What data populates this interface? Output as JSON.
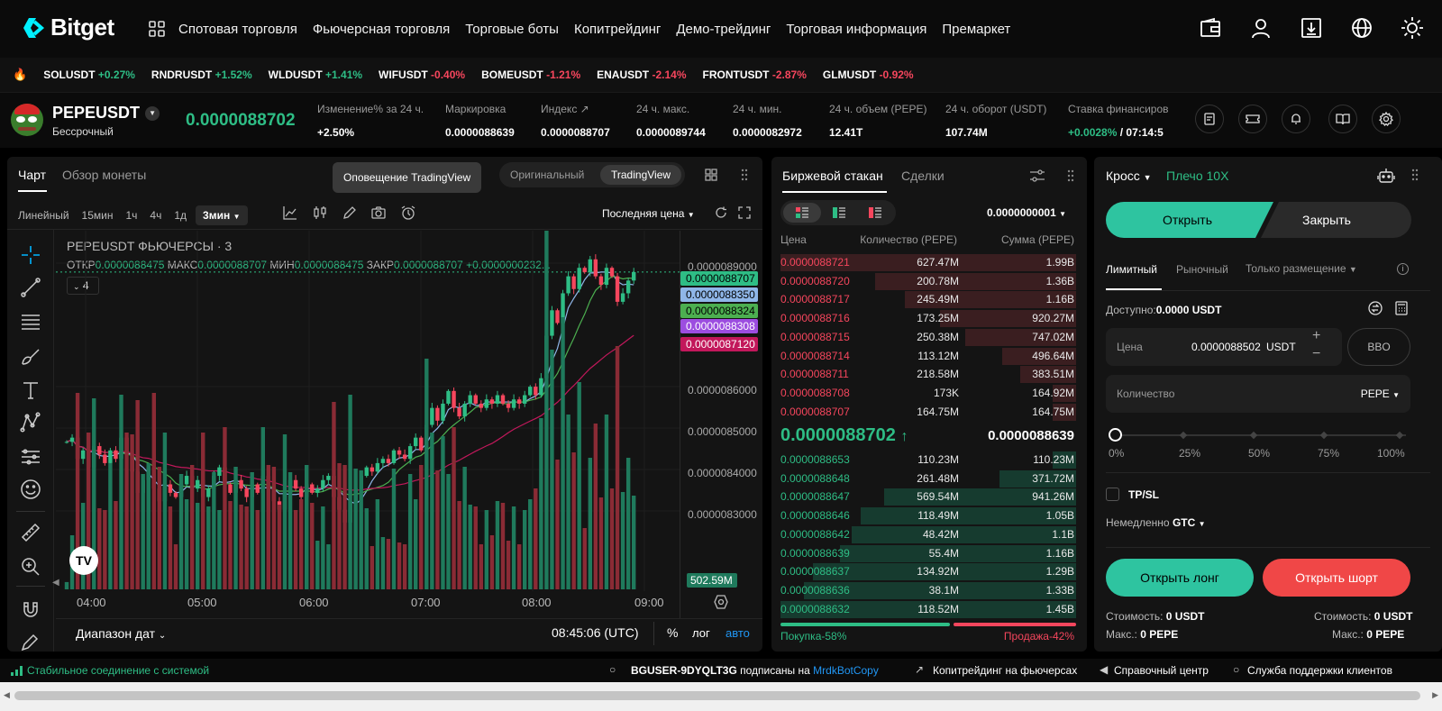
{
  "brand": {
    "name": "Bitget",
    "color": "#00f0ff"
  },
  "nav": [
    "Спотовая торговля",
    "Фьючерсная торговля",
    "Торговые боты",
    "Копитрейдинг",
    "Демо-трейдинг",
    "Торговая информация",
    "Премаркет"
  ],
  "header_icons": [
    "wallet-icon",
    "user-icon",
    "download-icon",
    "globe-icon",
    "sun-icon"
  ],
  "ticker": [
    {
      "sym": "SOLUSDT",
      "chg": "+0.27%",
      "dir": "up"
    },
    {
      "sym": "RNDRUSDT",
      "chg": "+1.52%",
      "dir": "up"
    },
    {
      "sym": "WLDUSDT",
      "chg": "+1.41%",
      "dir": "up"
    },
    {
      "sym": "WIFUSDT",
      "chg": "-0.40%",
      "dir": "dn"
    },
    {
      "sym": "BOMEUSDT",
      "chg": "-1.21%",
      "dir": "dn"
    },
    {
      "sym": "ENAUSDT",
      "chg": "-2.14%",
      "dir": "dn"
    },
    {
      "sym": "FRONTUSDT",
      "chg": "-2.87%",
      "dir": "dn"
    },
    {
      "sym": "GLMUSDT",
      "chg": "-0.92%",
      "dir": "dn"
    }
  ],
  "symbol": {
    "name": "PEPEUSDT",
    "type": "Бессрочный",
    "price": "0.0000088702",
    "stats": [
      {
        "label": "Изменение% за 24 ч.",
        "value": "+2.50%",
        "color": "#2ebd85"
      },
      {
        "label": "Маркировка",
        "value": "0.0000088639",
        "color": "#2ebd85"
      },
      {
        "label": "Индекс",
        "value": "0.0000088707",
        "color": "#ffffff"
      },
      {
        "label": "24 ч. макс.",
        "value": "0.0000089744",
        "color": "#ffffff"
      },
      {
        "label": "24 ч. мин.",
        "value": "0.0000082972",
        "color": "#ffffff"
      },
      {
        "label": "24 ч. объем (PEPE)",
        "value": "12.41T",
        "color": "#ffffff"
      },
      {
        "label": "24 ч. оборот (USDT)",
        "value": "107.74M",
        "color": "#ffffff"
      },
      {
        "label": "Ставка финансиров",
        "value": "+0.0028%",
        "color": "#2ebd85",
        "extra": " / 07:14:5"
      }
    ]
  },
  "chart": {
    "tabs": [
      "Чарт",
      "Обзор монеты"
    ],
    "tooltip": "Оповещение TradingView",
    "view_toggle": [
      "Оригинальный",
      "TradingView"
    ],
    "intervals": [
      "Линейный",
      "15мин",
      "1ч",
      "4ч",
      "1д"
    ],
    "active_interval": "3мин",
    "price_type": "Последняя цена",
    "legend_title": "PEPEUSDT ФЬЮЧЕРСЫ · 3",
    "ohlc": {
      "o_label": "ОТКР",
      "o": "0.0000088475",
      "h_label": "МАКС",
      "h": "0.0000088707",
      "l_label": "МИН",
      "l": "0.0000088475",
      "c_label": "ЗАКР",
      "c": "0.0000088707",
      "chg": "+0.0000000232..."
    },
    "indicator_count": "4",
    "y_ticks": [
      "0.0000089000",
      "0.0000086000",
      "0.0000085000",
      "0.0000084000",
      "0.0000083000"
    ],
    "price_tags": [
      {
        "v": "0.0000088707",
        "bg": "#2ebd85",
        "fg": "#000"
      },
      {
        "v": "0.0000088350",
        "bg": "#8fb6e8",
        "fg": "#000"
      },
      {
        "v": "0.0000088324",
        "bg": "#4caf50",
        "fg": "#000"
      },
      {
        "v": "0.0000088308",
        "bg": "#9c4de0",
        "fg": "#fff"
      },
      {
        "v": "0.0000087120",
        "bg": "#c2185b",
        "fg": "#fff"
      }
    ],
    "volume_tag": "502.59M",
    "x_ticks": [
      "04:00",
      "05:00",
      "06:00",
      "07:00",
      "08:00",
      "09:00"
    ],
    "date_range": "Диапазон дат",
    "time": "08:45:06 (UTC)",
    "scale_opts": [
      "%",
      "лог",
      "авто"
    ]
  },
  "book": {
    "tabs": [
      "Биржевой стакан",
      "Сделки"
    ],
    "precision": "0.0000000001",
    "headers": [
      "Цена",
      "Количество (PEPE)",
      "Сумма (PEPE)"
    ],
    "asks": [
      {
        "p": "0.0000088721",
        "q": "627.47M",
        "t": "1.99B",
        "d": 1.0
      },
      {
        "p": "0.0000088720",
        "q": "200.78M",
        "t": "1.36B",
        "d": 0.68
      },
      {
        "p": "0.0000088717",
        "q": "245.49M",
        "t": "1.16B",
        "d": 0.58
      },
      {
        "p": "0.0000088716",
        "q": "173.25M",
        "t": "920.27M",
        "d": 0.46
      },
      {
        "p": "0.0000088715",
        "q": "250.38M",
        "t": "747.02M",
        "d": 0.375
      },
      {
        "p": "0.0000088714",
        "q": "113.12M",
        "t": "496.64M",
        "d": 0.25
      },
      {
        "p": "0.0000088711",
        "q": "218.58M",
        "t": "383.51M",
        "d": 0.19
      },
      {
        "p": "0.0000088708",
        "q": "173K",
        "t": "164.92M",
        "d": 0.08
      },
      {
        "p": "0.0000088707",
        "q": "164.75M",
        "t": "164.75M",
        "d": 0.08
      }
    ],
    "last": "0.0000088702",
    "mark": "0.0000088639",
    "bids": [
      {
        "p": "0.0000088653",
        "q": "110.23M",
        "t": "110.23M",
        "d": 0.08
      },
      {
        "p": "0.0000088648",
        "q": "261.48M",
        "t": "371.72M",
        "d": 0.26
      },
      {
        "p": "0.0000088647",
        "q": "569.54M",
        "t": "941.26M",
        "d": 0.65
      },
      {
        "p": "0.0000088646",
        "q": "118.49M",
        "t": "1.05B",
        "d": 0.73
      },
      {
        "p": "0.0000088642",
        "q": "48.42M",
        "t": "1.1B",
        "d": 0.76
      },
      {
        "p": "0.0000088639",
        "q": "55.4M",
        "t": "1.16B",
        "d": 0.8
      },
      {
        "p": "0.0000088637",
        "q": "134.92M",
        "t": "1.29B",
        "d": 0.89
      },
      {
        "p": "0.0000088636",
        "q": "38.1M",
        "t": "1.33B",
        "d": 0.92
      },
      {
        "p": "0.0000088632",
        "q": "118.52M",
        "t": "1.45B",
        "d": 1.0
      }
    ],
    "buy_label": "Покупка-58%",
    "sell_label": "Продажа-42%",
    "buy_ratio": 0.58
  },
  "order": {
    "margin_mode": "Кросс",
    "leverage": "Плечо 10X",
    "open": "Открыть",
    "close": "Закрыть",
    "types": [
      "Лимитный",
      "Рыночный",
      "Только размещение"
    ],
    "available_label": "Доступно:",
    "available": "0.0000 USDT",
    "price_label": "Цена",
    "price_value": "0.0000088502",
    "price_unit": "USDT",
    "bbo": "BBO",
    "qty_label": "Количество",
    "qty_unit": "PEPE",
    "slider": [
      "0%",
      "25%",
      "50%",
      "75%",
      "100%"
    ],
    "tpsl": "TP/SL",
    "tif_label": "Немедленно",
    "tif": "GTC",
    "long": "Открыть лонг",
    "short": "Открыть шорт",
    "cost_label": "Стоимость:",
    "cost": "0 USDT",
    "max_label": "Макс.:",
    "max": "0 PEPE"
  },
  "footer": {
    "status": "Стабильное соединение с системой",
    "user": "BGUSER-9DYQLT3G",
    "subscribed": "подписаны на",
    "target": "MrdkBotCopy",
    "links": [
      "Копитрейдинг на фьючерсах",
      "Справочный центр",
      "Служба поддержки клиентов"
    ]
  },
  "chart_data": {
    "type": "candlestick",
    "x_ticks": [
      "04:00",
      "05:00",
      "06:00",
      "07:00",
      "08:00",
      "09:00"
    ],
    "ylim": [
      8.25e-06,
      8.925e-06
    ],
    "close": [
      8.47,
      8.48,
      8.43,
      8.45,
      8.41,
      8.46,
      8.44,
      8.42,
      8.45,
      8.43,
      8.48,
      8.44,
      8.4,
      8.35,
      8.38,
      8.41,
      8.36,
      8.33,
      8.37,
      8.35,
      8.34,
      8.37,
      8.39,
      8.36,
      8.38,
      8.34,
      8.36,
      8.39,
      8.41,
      8.37,
      8.35,
      8.38,
      8.36,
      8.34,
      8.37,
      8.35,
      8.39,
      8.36,
      8.33,
      8.31,
      8.35,
      8.38,
      8.36,
      8.34,
      8.37,
      8.35,
      8.36,
      8.38,
      8.39,
      8.34,
      8.31,
      8.28,
      8.33,
      8.36,
      8.39,
      8.41,
      8.4,
      8.42,
      8.43,
      8.42,
      8.45,
      8.44,
      8.43,
      8.46,
      8.48,
      8.45,
      8.51,
      8.55,
      8.52,
      8.56,
      8.59,
      8.55,
      8.53,
      8.56,
      8.58,
      8.56,
      8.55,
      8.57,
      8.56,
      8.58,
      8.56,
      8.55,
      8.57,
      8.56,
      8.58,
      8.6,
      8.58,
      8.62,
      8.72,
      8.78,
      8.75,
      8.82,
      8.86,
      8.83,
      8.88,
      8.87,
      8.9,
      8.86,
      8.84,
      8.88,
      8.86,
      8.8,
      8.82,
      8.85,
      8.87
    ]
  }
}
